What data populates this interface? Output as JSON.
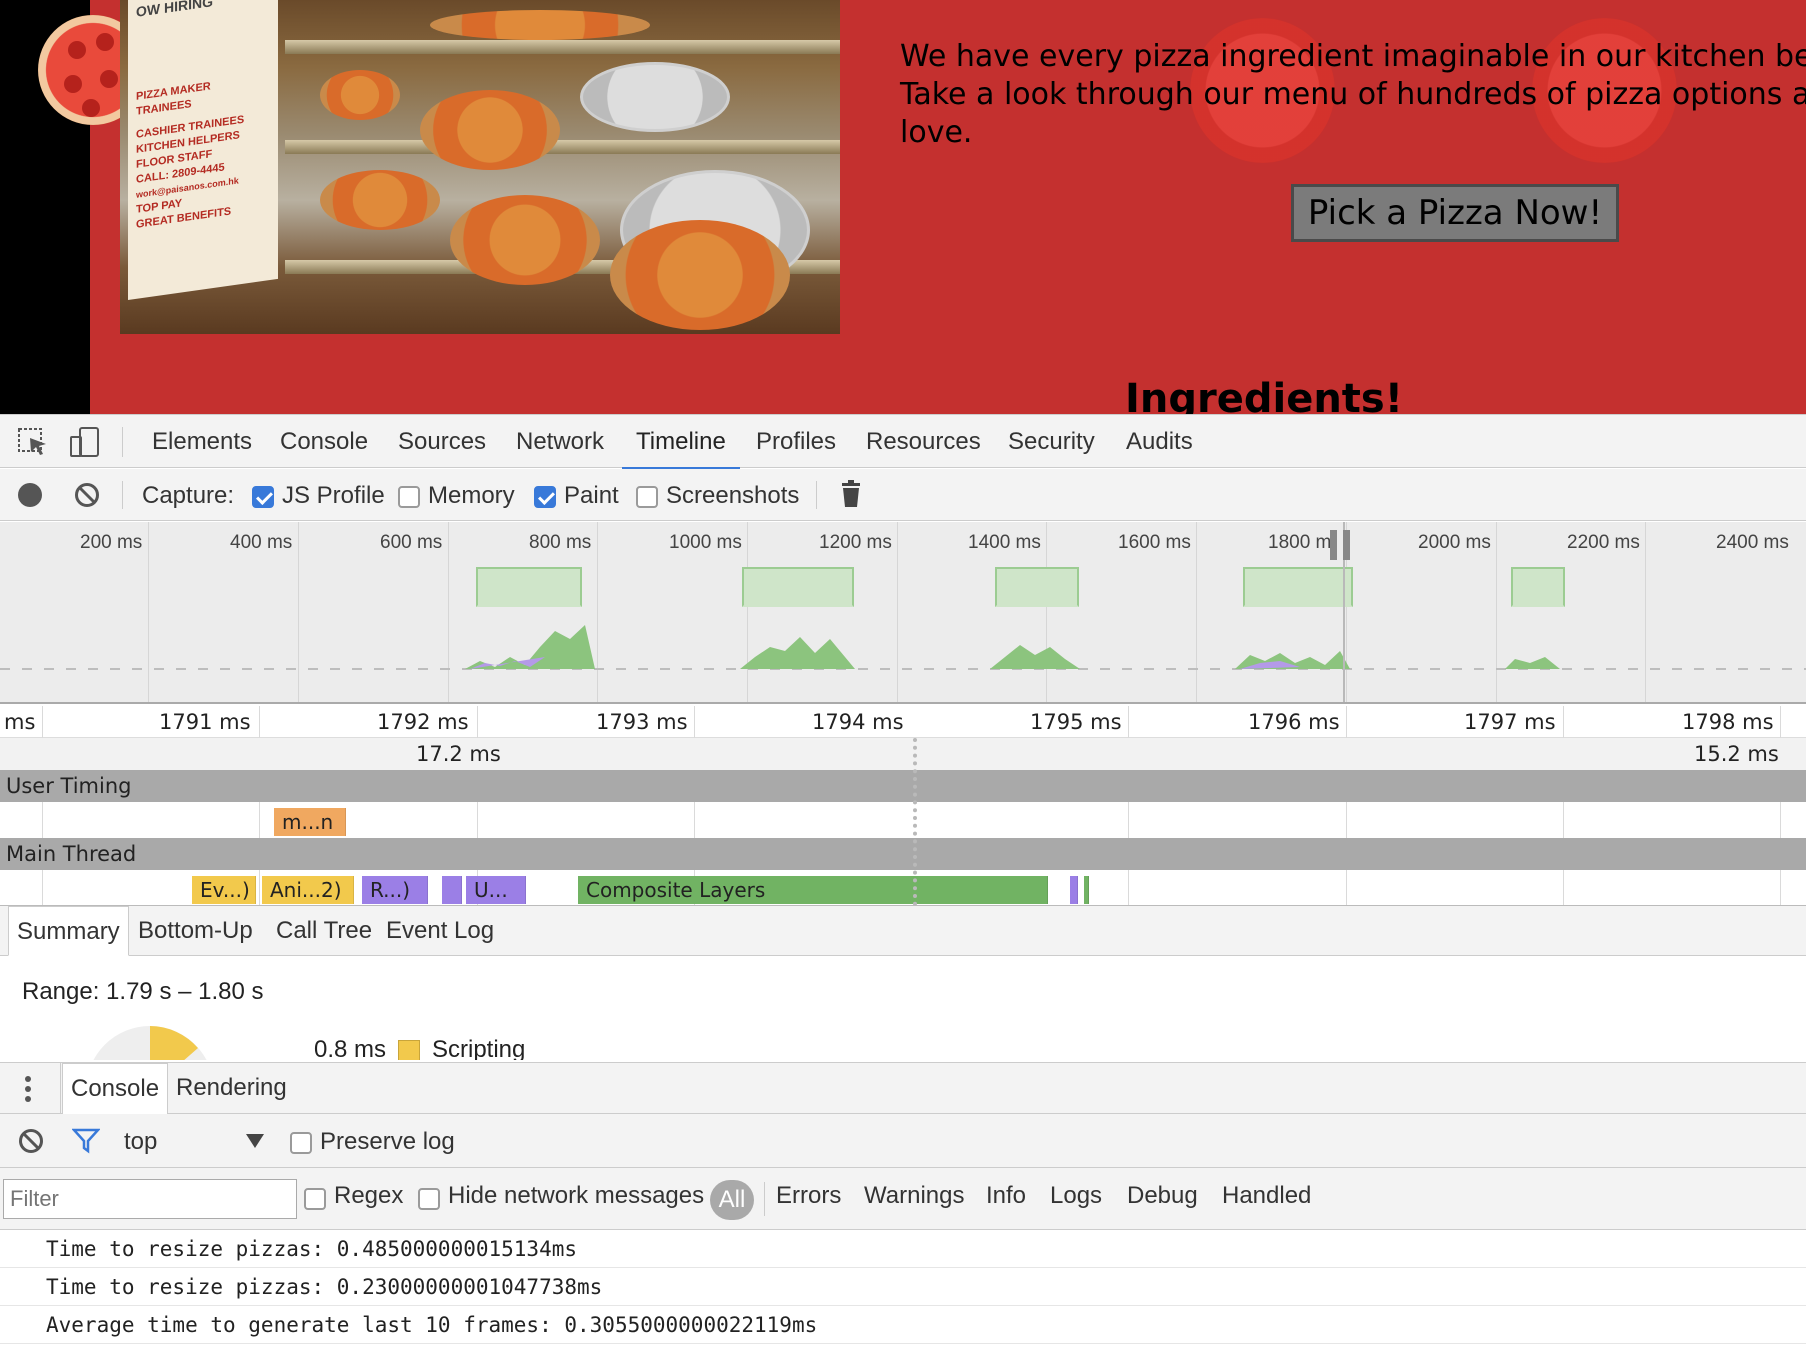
{
  "webpage": {
    "banner_lines": [
      "OW HIRING",
      "PIZZA MAKER",
      "TRAINEES",
      "CASHIER TRAINEES",
      "KITCHEN HELPERS",
      "FLOOR STAFF",
      "CALL: 2809-4445",
      "work@paisanos.com.hk",
      "TOP PAY",
      "GREAT BENEFITS"
    ],
    "intro_text": "We have every pizza ingredient imaginable in our kitchen beca\nTake a look through our menu of hundreds of pizza options and\nlove.",
    "cta_button": "Pick a Pizza Now!",
    "heading": "Ingredients!"
  },
  "devtools": {
    "tabs": [
      "Elements",
      "Console",
      "Sources",
      "Network",
      "Timeline",
      "Profiles",
      "Resources",
      "Security",
      "Audits"
    ],
    "active_tab": "Timeline",
    "toolbar": {
      "capture_label": "Capture:",
      "js_profile": {
        "label": "JS Profile",
        "checked": true
      },
      "memory": {
        "label": "Memory",
        "checked": false
      },
      "paint": {
        "label": "Paint",
        "checked": true
      },
      "screenshots": {
        "label": "Screenshots",
        "checked": false
      }
    },
    "overview": {
      "ticks": [
        "200 ms",
        "400 ms",
        "600 ms",
        "800 ms",
        "1000 ms",
        "1200 ms",
        "1400 ms",
        "1600 ms",
        "1800 m",
        "2000 ms",
        "2200 ms",
        "2400 ms"
      ]
    },
    "flame": {
      "ruler_ticks": [
        "ms",
        "1791 ms",
        "1792 ms",
        "1793 ms",
        "1794 ms",
        "1795 ms",
        "1796 ms",
        "1797 ms",
        "1798 ms"
      ],
      "frame_durations": [
        "17.2 ms",
        "15.2 ms"
      ],
      "tracks": {
        "user_timing": "User Timing",
        "main_thread": "Main Thread"
      },
      "user_timing_events": [
        "m...n"
      ],
      "main_thread_events": [
        "Ev...)",
        "Ani...2)",
        "R...)",
        "",
        "U...",
        "Composite Layers",
        "",
        ""
      ],
      "colors": {
        "scripting": "#f2c94c",
        "rendering": "#9b7fe6",
        "painting": "#71b363",
        "user_timing": "#f0a860"
      }
    },
    "details_tabs": [
      "Summary",
      "Bottom-Up",
      "Call Tree",
      "Event Log"
    ],
    "summary": {
      "range": "Range: 1.79 s – 1.80 s",
      "scripting_time": "0.8 ms",
      "scripting_label": "Scripting"
    },
    "drawer": {
      "tabs": [
        "Console",
        "Rendering"
      ],
      "context": "top",
      "preserve_log": "Preserve log",
      "filter_placeholder": "Filter",
      "regex": "Regex",
      "hide_network": "Hide network messages",
      "levels": [
        "All",
        "Errors",
        "Warnings",
        "Info",
        "Logs",
        "Debug",
        "Handled"
      ],
      "messages": [
        "Time to resize pizzas: 0.485000000015134ms",
        "Time to resize pizzas: 0.23000000001047738ms",
        "Average time to generate last 10 frames: 0.3055000000022119ms"
      ]
    }
  }
}
